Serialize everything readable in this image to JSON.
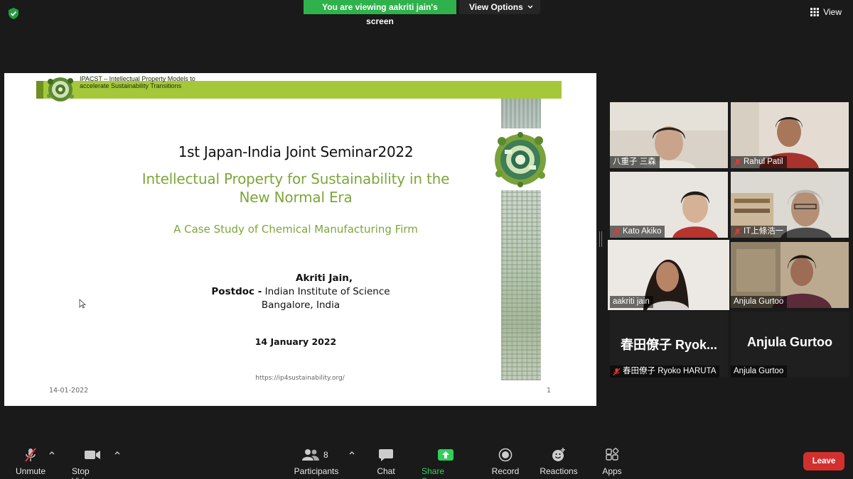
{
  "top": {
    "banner_text": "You are viewing aakriti jain's screen",
    "view_options_label": "View Options",
    "view_label": "View"
  },
  "slide": {
    "header_line1": "IPACST – Intellectual Property Models to",
    "header_line2": "accelerate Sustainability Transitions",
    "seminar_title": "1st Japan-India Joint Seminar2022",
    "title_line1": "Intellectual Property for Sustainability in the",
    "title_line2": "New Normal Era",
    "subtitle": "A Case Study of Chemical Manufacturing Firm",
    "author": "Akriti Jain,",
    "position_bold": "Postdoc -",
    "position_rest": " Indian Institute of Science",
    "city": "Bangalore, India",
    "date": "14 January 2022",
    "url": "https://ip4sustainability.org/",
    "footer_date": "14-01-2022",
    "page_number": "1",
    "accent_color": "#7ea63a",
    "header_bar_color": "#a5c83a"
  },
  "participants_gallery": [
    {
      "name": "八重子 三森",
      "muted": false
    },
    {
      "name": "Rahul Patil",
      "muted": true
    },
    {
      "name": "Kato Akiko",
      "muted": true
    },
    {
      "name": "IT上條浩一",
      "muted": true
    },
    {
      "name": "aakriti jain",
      "muted": false,
      "active_speaker": true
    },
    {
      "name": "Anjula Gurtoo",
      "muted": false
    },
    {
      "name": "春田僚子 Ryoko HARUTA",
      "display": "春田僚子 Ryok...",
      "muted": true
    },
    {
      "name": "Anjula Gurtoo",
      "display": "Anjula Gurtoo",
      "muted": false
    }
  ],
  "toolbar": {
    "unmute": "Unmute",
    "stop_video": "Stop Video",
    "participants": "Participants",
    "participants_count": "8",
    "chat": "Chat",
    "share_screen": "Share Screen",
    "record": "Record",
    "reactions": "Reactions",
    "apps": "Apps",
    "leave": "Leave",
    "share_color": "#2fd05a",
    "leave_color": "#d2302f"
  }
}
